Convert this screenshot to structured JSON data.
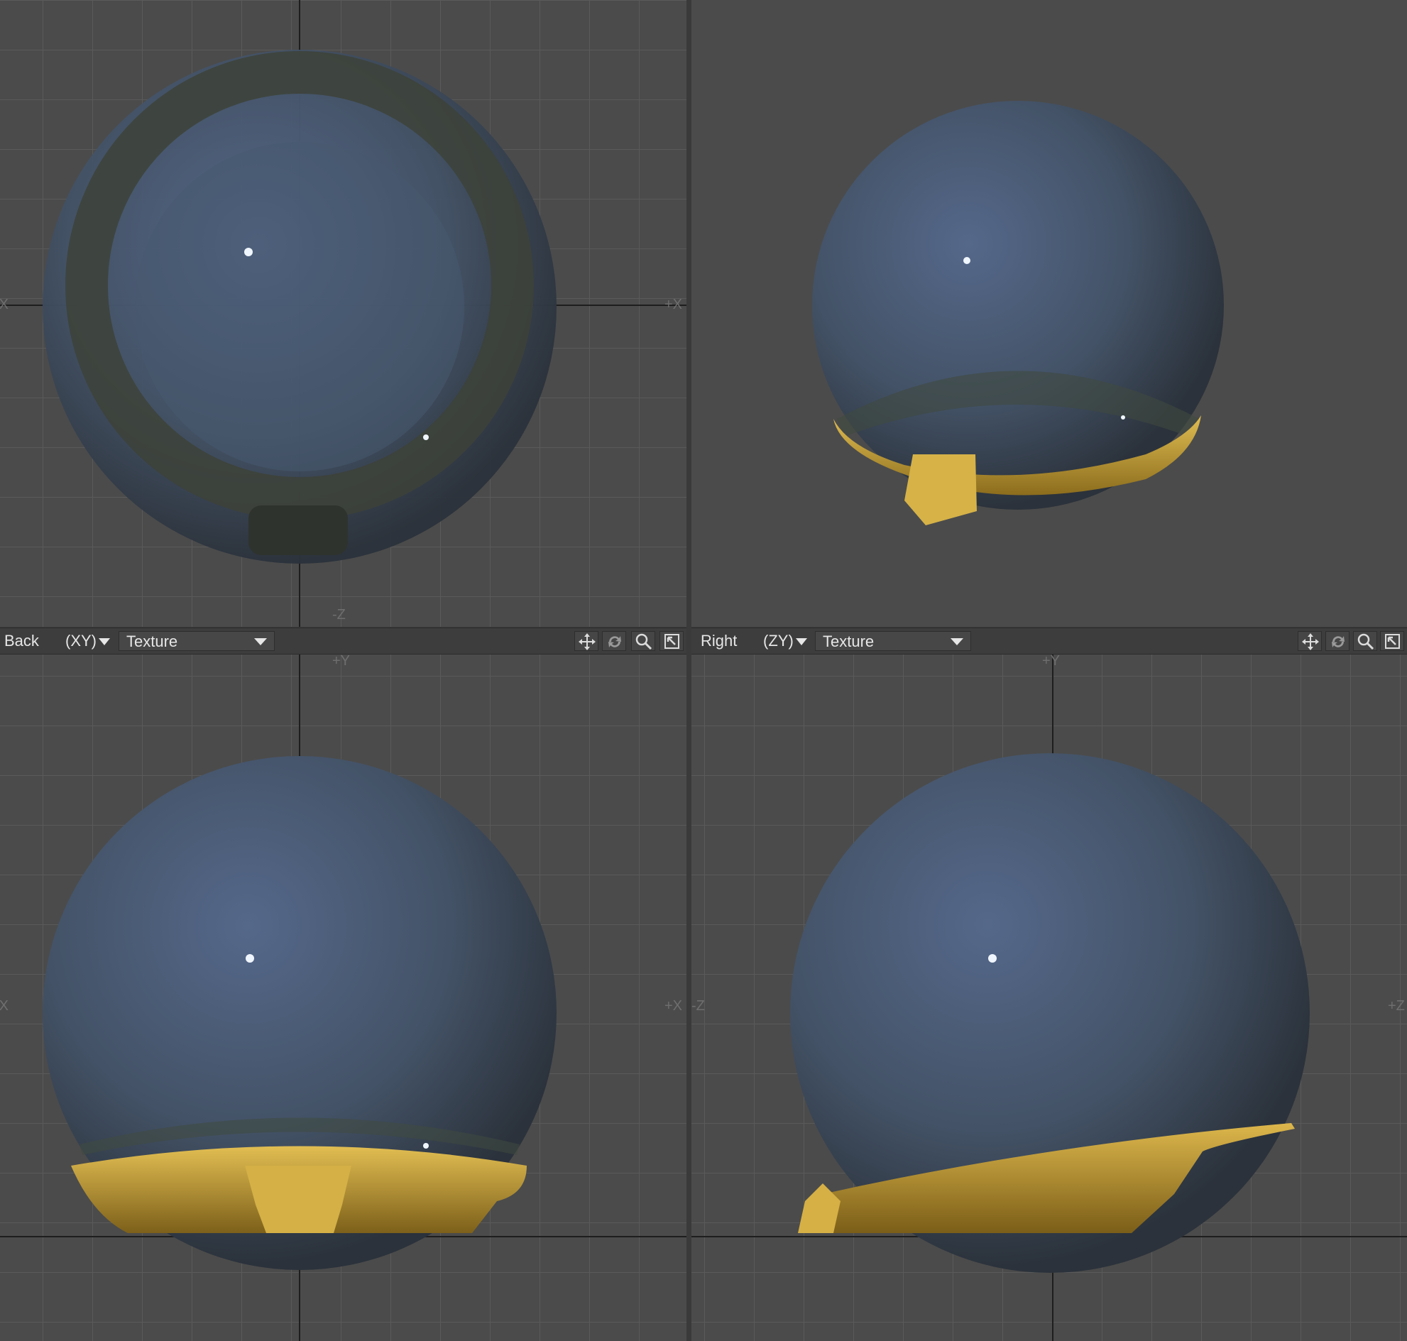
{
  "viewports": {
    "top_left": {
      "axis_labels": {
        "left": "-X",
        "right": "+X",
        "bottom": "-Z"
      }
    },
    "top_right": {},
    "bottom_left": {
      "view_name": "Back",
      "projection": "(XY)",
      "render_mode": "Texture",
      "axis_labels": {
        "top": "+Y",
        "left": "-X",
        "right": "+X"
      }
    },
    "bottom_right": {
      "view_name": "Right",
      "projection": "(ZY)",
      "render_mode": "Texture",
      "axis_labels": {
        "top": "+Y",
        "left": "-Z",
        "right": "+Z"
      }
    }
  },
  "toolbar_icons": [
    "move-view-icon",
    "rotate-view-icon",
    "zoom-view-icon",
    "maximize-viewport-icon"
  ],
  "colors": {
    "viewport_bg": "#4b4b4b",
    "grid_line": "#5a5a5a",
    "axis_line": "#1e1e1e",
    "sphere": "#4a5a6e",
    "gold": "#c8a23a"
  }
}
